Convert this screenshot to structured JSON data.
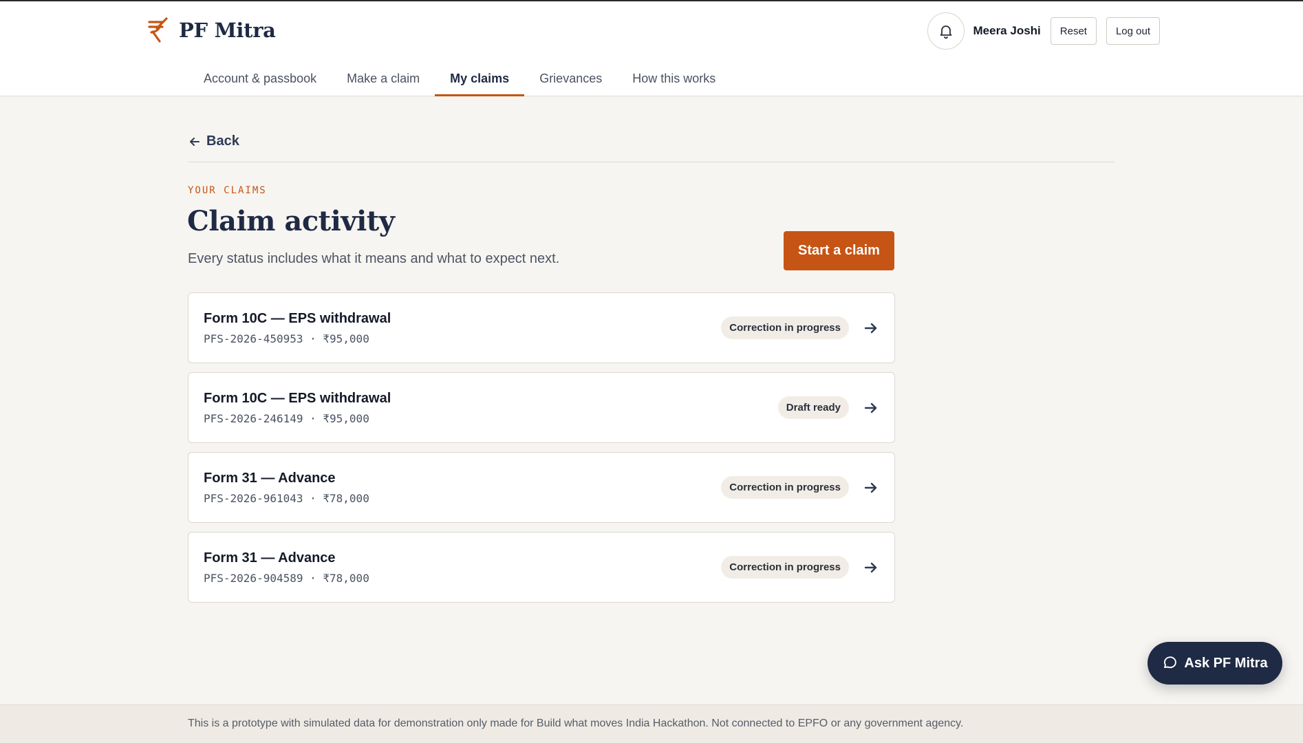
{
  "brand": {
    "name": "PF Mitra",
    "accent": "#c65414",
    "navy": "#1f2a44"
  },
  "header": {
    "user_name": "Meera Joshi",
    "reset_label": "Reset",
    "logout_label": "Log out"
  },
  "nav": {
    "items": [
      {
        "label": "Account & passbook",
        "active": false
      },
      {
        "label": "Make a claim",
        "active": false
      },
      {
        "label": "My claims",
        "active": true
      },
      {
        "label": "Grievances",
        "active": false
      },
      {
        "label": "How this works",
        "active": false
      }
    ]
  },
  "main": {
    "back_label": "Back",
    "eyebrow": "YOUR CLAIMS",
    "title": "Claim activity",
    "subtitle": "Every status includes what it means and what to expect next.",
    "start_button": "Start a claim"
  },
  "claims": [
    {
      "title": "Form 10C — EPS withdrawal",
      "meta": "PFS-2026-450953 · ₹95,000",
      "status": "Correction in progress"
    },
    {
      "title": "Form 10C — EPS withdrawal",
      "meta": "PFS-2026-246149 · ₹95,000",
      "status": "Draft ready"
    },
    {
      "title": "Form 31 — Advance",
      "meta": "PFS-2026-961043 · ₹78,000",
      "status": "Correction in progress"
    },
    {
      "title": "Form 31 — Advance",
      "meta": "PFS-2026-904589 · ₹78,000",
      "status": "Correction in progress"
    }
  ],
  "assistant": {
    "label": "Ask PF Mitra"
  },
  "footer": {
    "text": "This is a prototype with simulated data for demonstration only made for Build what moves India Hackathon. Not connected to EPFO or any government agency."
  },
  "icons": [
    "rupee-logo-icon",
    "bell-icon",
    "arrow-left-icon",
    "arrow-right-icon",
    "chat-bubble-icon"
  ]
}
